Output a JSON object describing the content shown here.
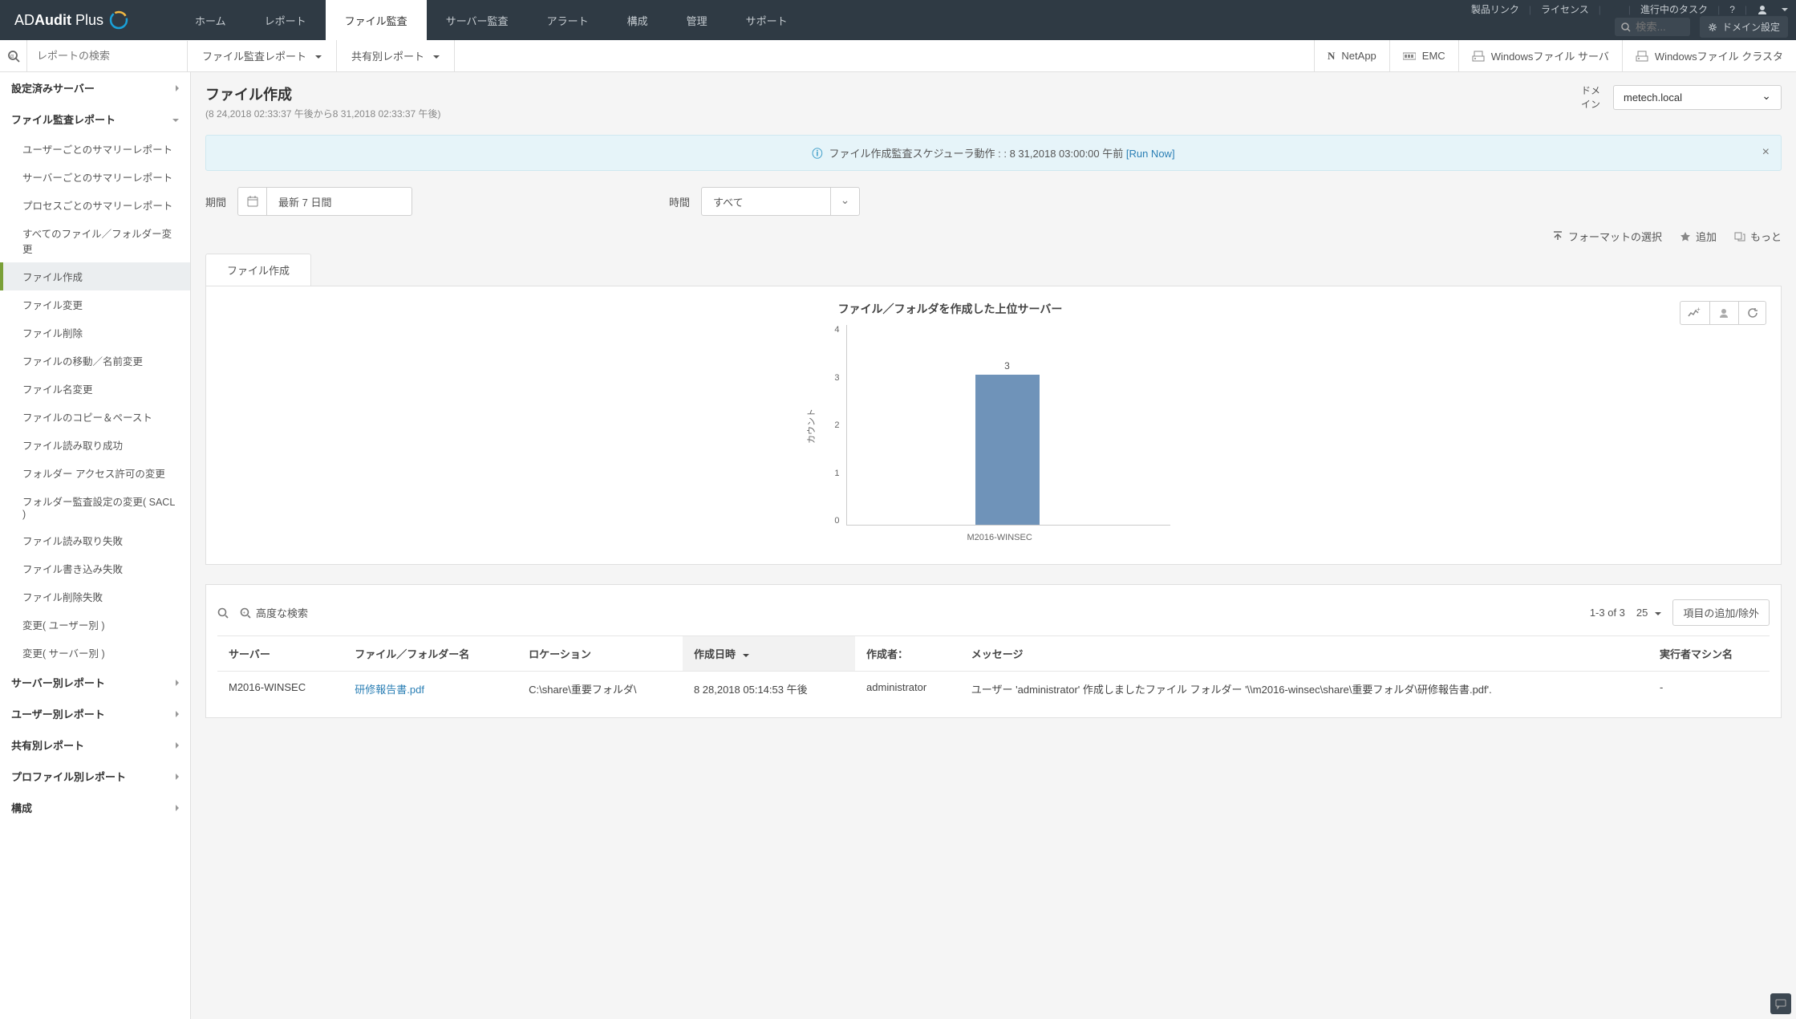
{
  "brand": {
    "name_a": "AD",
    "name_b": "Audit",
    "name_c": " Plus"
  },
  "topbar": {
    "links": {
      "product": "製品リンク",
      "license": "ライセンス",
      "tasks": "進行中のタスク"
    },
    "search_placeholder": "検索...",
    "domain_config": "ドメイン設定"
  },
  "main_nav": [
    "ホーム",
    "レポート",
    "ファイル監査",
    "サーバー監査",
    "アラート",
    "構成",
    "管理",
    "サポート"
  ],
  "main_nav_active": 2,
  "sub_bar": {
    "search_placeholder": "レポートの検索",
    "left": [
      "ファイル監査レポート",
      "共有別レポート"
    ],
    "right": [
      {
        "icon": "N",
        "label": "NetApp"
      },
      {
        "icon": "emc",
        "label": "EMC"
      },
      {
        "icon": "win",
        "label": "Windowsファイル サーバ"
      },
      {
        "icon": "win",
        "label": "Windowsファイル クラスタ"
      }
    ]
  },
  "sidebar": {
    "groups": [
      {
        "label": "設定済みサーバー",
        "expanded": false
      },
      {
        "label": "ファイル監査レポート",
        "expanded": true,
        "items": [
          "ユーザーごとのサマリーレポート",
          "サーバーごとのサマリーレポート",
          "プロセスごとのサマリーレポート",
          "すべてのファイル／フォルダー変更",
          "ファイル作成",
          "ファイル変更",
          "ファイル削除",
          "ファイルの移動／名前変更",
          "ファイル名変更",
          "ファイルのコピー＆ペースト",
          "ファイル読み取り成功",
          "フォルダー アクセス許可の変更",
          "フォルダー監査設定の変更( SACL )",
          "ファイル読み取り失敗",
          "ファイル書き込み失敗",
          "ファイル削除失敗",
          "変更( ユーザー別 )",
          "変更( サーバー別 )"
        ],
        "active_item": 4
      },
      {
        "label": "サーバー別レポート",
        "expanded": false
      },
      {
        "label": "ユーザー別レポート",
        "expanded": false
      },
      {
        "label": "共有別レポート",
        "expanded": false
      },
      {
        "label": "プロファイル別レポート",
        "expanded": false
      },
      {
        "label": "構成",
        "expanded": false
      }
    ]
  },
  "page": {
    "title": "ファイル作成",
    "subtitle": "(8 24,2018 02:33:37 午後から8 31,2018 02:33:37 午後)",
    "domain_label": "ドメイン",
    "domain_value": "metech.local"
  },
  "banner": {
    "text": "ファイル作成監査スケジューラ動作 : : 8 31,2018 03:00:00 午前 ",
    "run_now": "[Run Now]"
  },
  "filters": {
    "period_label": "期間",
    "period_value": "最新 7 日間",
    "hour_label": "時間",
    "hour_value": "すべて"
  },
  "actions": {
    "format": "フォーマットの選択",
    "add": "追加",
    "more": "もっと"
  },
  "tabs": [
    {
      "label": "ファイル作成",
      "active": true
    }
  ],
  "chart_data": {
    "type": "bar",
    "title": "ファイル／フォルダを作成した上位サーバー",
    "ylabel": "カウント",
    "categories": [
      "M2016-WINSEC"
    ],
    "values": [
      3
    ],
    "ylim": [
      0,
      4
    ],
    "yticks": [
      0,
      1,
      2,
      3,
      4
    ]
  },
  "table": {
    "adv_search": "高度な検索",
    "range": "1-3 of 3",
    "page_size": "25",
    "columns_btn": "項目の追加/除外",
    "headers": [
      "サーバー",
      "ファイル／フォルダー名",
      "ロケーション",
      "作成日時",
      "作成者：",
      "メッセージ",
      "実行者マシン名"
    ],
    "sorted_col": 3,
    "rows": [
      {
        "server": "M2016-WINSEC",
        "file": "研修報告書.pdf",
        "location": "C:\\share\\重要フォルダ\\",
        "time": "8 28,2018 05:14:53 午後",
        "creator": "administrator",
        "message": "ユーザー 'administrator' 作成しましたファイル フォルダー '\\\\m2016-winsec\\share\\重要フォルダ\\研修報告書.pdf'.",
        "machine": "-"
      }
    ]
  }
}
